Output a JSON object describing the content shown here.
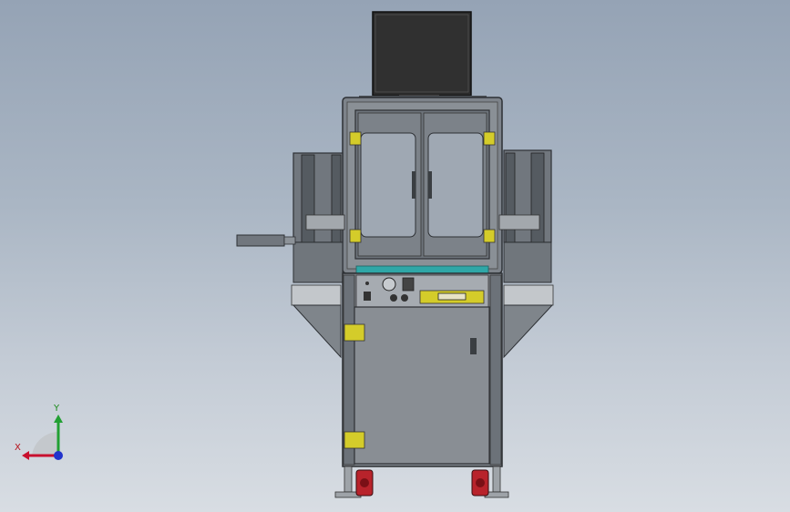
{
  "viewport": {
    "background_top": "#95a3b5",
    "background_bottom": "#d8dde3",
    "model": "machine-assembly-front-view"
  },
  "triad": {
    "x_label": "X",
    "y_label": "Y",
    "x_color": "#c8102e",
    "y_color": "#22a033",
    "z_color": "#2233cc"
  },
  "colors": {
    "frame": "#6e747b",
    "frame_light": "#9aa0a7",
    "panel": "#898e94",
    "glass": "#9fa8b3",
    "teal_strip": "#2fa7a7",
    "hinge": "#d4cc2a",
    "wheel": "#b8232b",
    "monitor": "#2b2b2b",
    "lcd": "#e7e3c5"
  }
}
